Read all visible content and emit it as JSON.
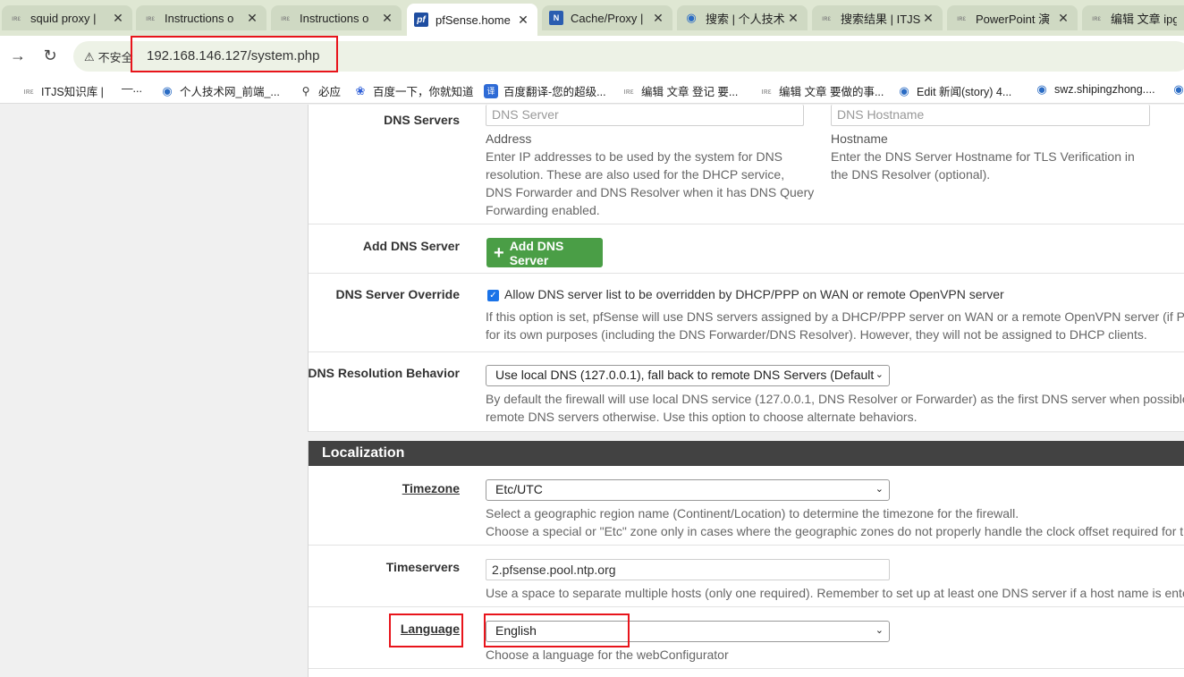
{
  "tabs": [
    {
      "title": "squid proxy |",
      "icon": "itjs-favicon"
    },
    {
      "title": "Instructions o",
      "icon": "itjs-favicon"
    },
    {
      "title": "Instructions o",
      "icon": "itjs-favicon"
    },
    {
      "title": "pfSense.home",
      "icon": "pfsense-favicon",
      "active": true
    },
    {
      "title": "Cache/Proxy |",
      "icon": "netgate-favicon"
    },
    {
      "title": "搜索 | 个人技术",
      "icon": "globe-favicon"
    },
    {
      "title": "搜索结果 | ITJS",
      "icon": "itjs-favicon"
    },
    {
      "title": "PowerPoint 演",
      "icon": "itjs-favicon"
    },
    {
      "title": "编辑 文章 ipgu",
      "icon": "itjs-favicon"
    }
  ],
  "address_bar": {
    "security_label": "不安全",
    "url": "192.168.146.127/system.php"
  },
  "bookmarks": [
    {
      "label": "ITJS知识库 |",
      "icon": "itjs-favicon"
    },
    {
      "label": "—...",
      "icon": "blank"
    },
    {
      "label": "个人技术网_前端_...",
      "icon": "globe-favicon"
    },
    {
      "label": "必应",
      "icon": "search-icon"
    },
    {
      "label": "百度一下，你就知道",
      "icon": "baidu-paw-icon"
    },
    {
      "label": "百度翻译-您的超级...",
      "icon": "translate-icon"
    },
    {
      "label": "编辑 文章 登记 要...",
      "icon": "itjs-favicon"
    },
    {
      "label": "编辑 文章 要做的事...",
      "icon": "itjs-favicon"
    },
    {
      "label": "Edit 新闻(story) 4...",
      "icon": "globe-favicon"
    },
    {
      "label": "swz.shipingzhong....",
      "icon": "globe-favicon"
    }
  ],
  "dns_servers": {
    "label": "DNS Servers",
    "address_placeholder": "DNS Server",
    "address_title": "Address",
    "address_help": [
      "Enter IP addresses to be used by the system for DNS",
      "resolution. These are also used for the DHCP service,",
      "DNS Forwarder and DNS Resolver when it has DNS Query",
      "Forwarding enabled."
    ],
    "hostname_placeholder": "DNS Hostname",
    "hostname_title": "Hostname",
    "hostname_help": [
      "Enter the DNS Server Hostname for TLS Verification in",
      "the DNS Resolver (optional)."
    ]
  },
  "add_dns_server": {
    "label": "Add DNS Server",
    "button": "Add DNS Server"
  },
  "dns_override": {
    "label": "DNS Server Override",
    "checked": true,
    "checkbox_label": "Allow DNS server list to be overridden by DHCP/PPP on WAN or remote OpenVPN server",
    "help": [
      "If this option is set, pfSense will use DNS servers assigned by a DHCP/PPP server on WAN or a remote OpenVPN server (if Pul",
      "for its own purposes (including the DNS Forwarder/DNS Resolver). However, they will not be assigned to DHCP clients."
    ]
  },
  "dns_resolution": {
    "label": "DNS Resolution Behavior",
    "selected": "Use local DNS (127.0.0.1), fall back to remote DNS Servers (Default",
    "help": [
      "By default the firewall will use local DNS service (127.0.0.1, DNS Resolver or Forwarder) as the first DNS server when possible,",
      "remote DNS servers otherwise. Use this option to choose alternate behaviors."
    ]
  },
  "localization": {
    "section_title": "Localization",
    "timezone": {
      "label": "Timezone",
      "selected": "Etc/UTC",
      "help": [
        "Select a geographic region name (Continent/Location) to determine the timezone for the firewall.",
        "Choose a special or \"Etc\" zone only in cases where the geographic zones do not properly handle the clock offset required for th"
      ]
    },
    "timeservers": {
      "label": "Timeservers",
      "value": "2.pfsense.pool.ntp.org",
      "help": "Use a space to separate multiple hosts (only one required). Remember to set up at least one DNS server if a host name is enter"
    },
    "language": {
      "label": "Language",
      "selected": "English",
      "help": "Choose a language for the webConfigurator"
    }
  },
  "colors": {
    "tabbar_bg": "#dfe7d3",
    "highlight_box": "#e8141b",
    "add_button": "#4a9e46",
    "section_header": "#424242"
  }
}
